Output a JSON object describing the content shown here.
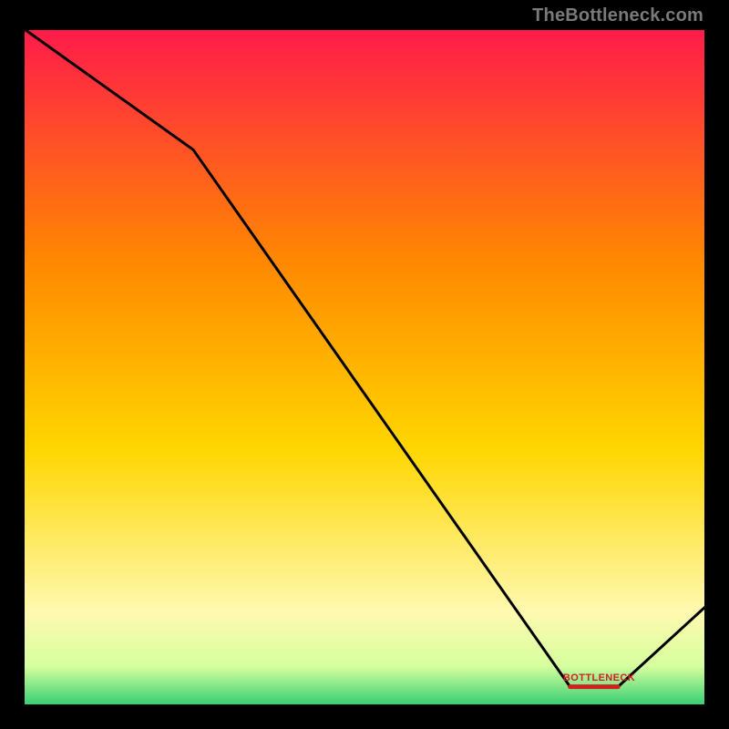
{
  "attribution": "TheBottleneck.com",
  "marker": {
    "label": "BOTTLENECK"
  },
  "chart_data": {
    "type": "line",
    "title": "",
    "xlabel": "",
    "ylabel": "",
    "xlim": [
      0,
      100
    ],
    "ylim": [
      0,
      100
    ],
    "x": [
      0,
      25,
      80,
      87,
      100
    ],
    "values": [
      100,
      82,
      3,
      3,
      15
    ],
    "background_gradient_colors": [
      "#ff1a4b",
      "#ffd600",
      "#fff9c0",
      "#2ecc71"
    ],
    "marker_range_x": [
      80,
      87
    ]
  }
}
